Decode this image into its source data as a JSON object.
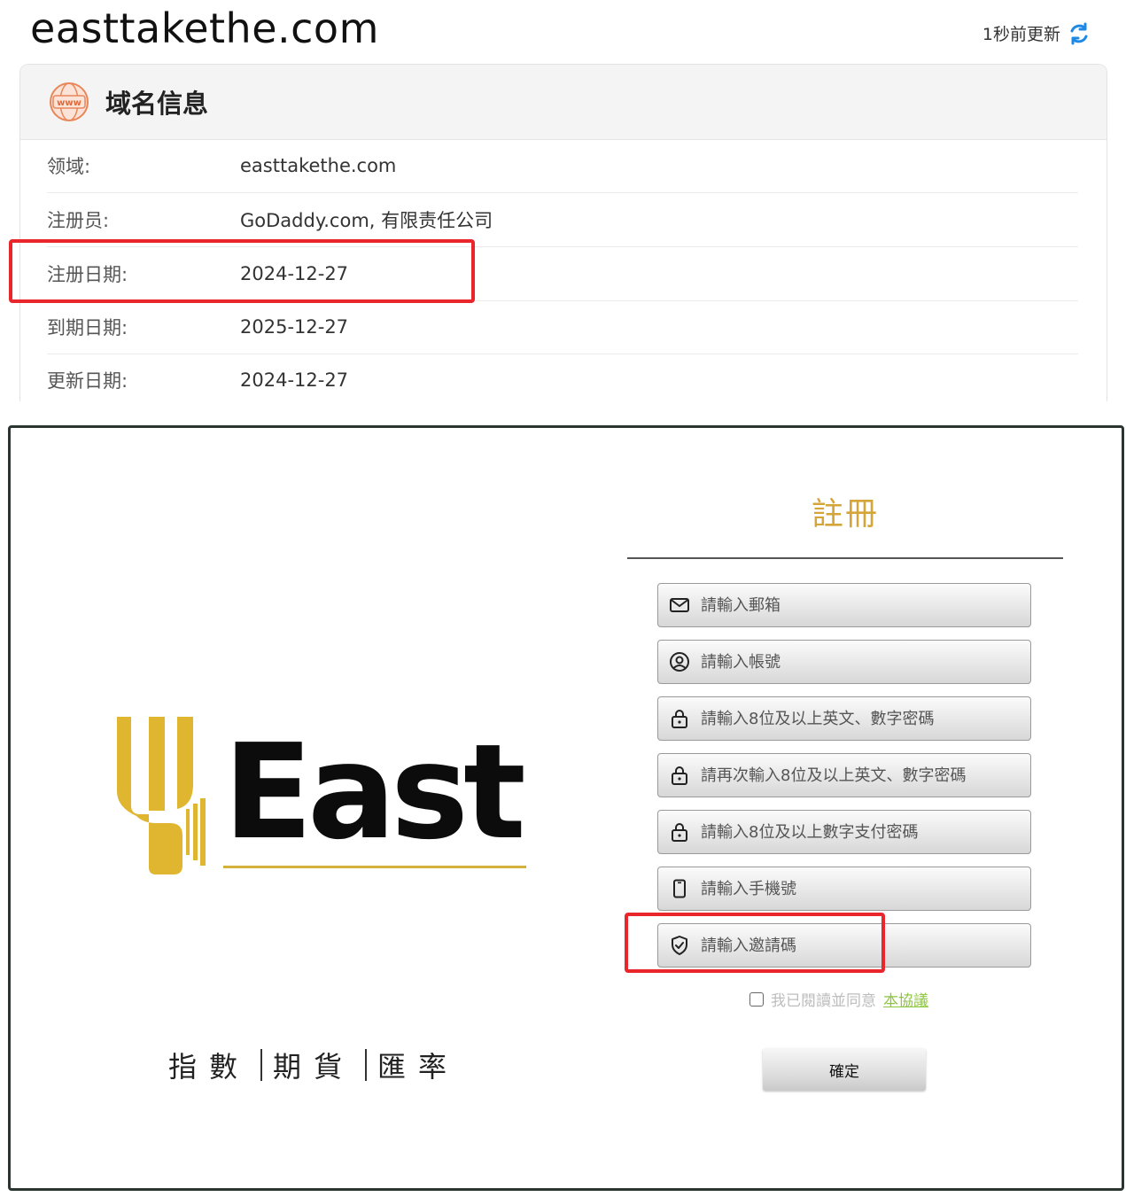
{
  "whois": {
    "domain": "easttakethe.com",
    "refresh_text": "1秒前更新",
    "card_title": "域名信息",
    "badge_text": "www",
    "rows": [
      {
        "label": "领域:",
        "value": "easttakethe.com"
      },
      {
        "label": "注册员:",
        "value": "GoDaddy.com, 有限责任公司"
      },
      {
        "label": "注册日期:",
        "value": "2024-12-27"
      },
      {
        "label": "到期日期:",
        "value": "2025-12-27"
      },
      {
        "label": "更新日期:",
        "value": "2024-12-27"
      }
    ]
  },
  "register": {
    "logo_text": "East",
    "tagline": [
      "指數",
      "期貨",
      "匯率"
    ],
    "title": "註冊",
    "fields": [
      {
        "icon": "mail-icon",
        "placeholder": "請輸入郵箱"
      },
      {
        "icon": "user-circle-icon",
        "placeholder": "請輸入帳號"
      },
      {
        "icon": "lock-icon",
        "placeholder": "請輸入8位及以上英文、數字密碼"
      },
      {
        "icon": "lock-icon",
        "placeholder": "請再次輸入8位及以上英文、數字密碼"
      },
      {
        "icon": "lock-icon",
        "placeholder": "請輸入8位及以上數字支付密碼"
      },
      {
        "icon": "phone-icon",
        "placeholder": "請輸入手機號"
      },
      {
        "icon": "shield-check-icon",
        "placeholder": "請輸入邀請碼"
      }
    ],
    "agree_text": "我已閱讀並同意",
    "agree_link": "本協議",
    "confirm_label": "確定"
  },
  "colors": {
    "highlight": "#e8262c",
    "title_gold": "#d6a53a",
    "logo_gold": "#e0b52f",
    "link_green": "#8dc63f",
    "refresh_blue": "#1e88e5"
  }
}
